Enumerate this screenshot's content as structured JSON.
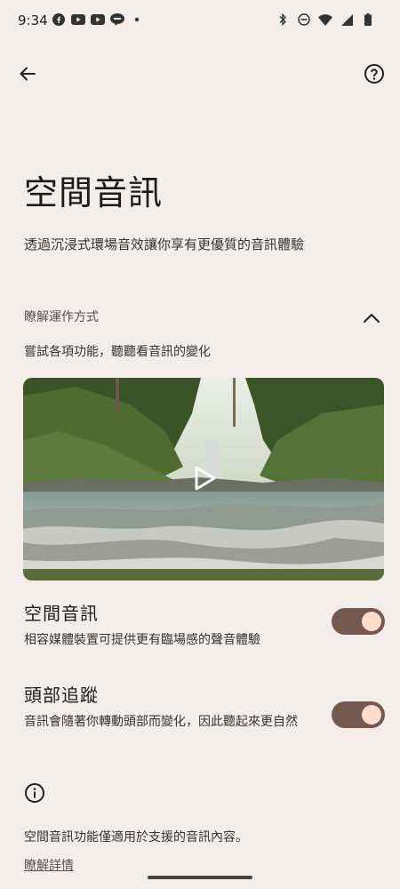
{
  "status_bar": {
    "time": "9:34",
    "left_icons": [
      "facebook-icon",
      "youtube-icon",
      "youtube-icon",
      "line-icon",
      "dot-icon"
    ],
    "right_icons": [
      "bluetooth-icon",
      "do-not-disturb-icon",
      "wifi-icon",
      "signal-icon",
      "battery-icon"
    ]
  },
  "nav": {
    "back_icon": "arrow-back-icon",
    "help_icon": "help-icon"
  },
  "page": {
    "title": "空間音訊",
    "subtitle": "透過沉浸式環場音效讓你享有更優質的音訊體驗"
  },
  "how_it_works": {
    "label": "瞭解運作方式",
    "expanded": true,
    "hint": "嘗試各項功能，聽聽看音訊的變化"
  },
  "video": {
    "play_icon": "play-icon"
  },
  "settings": [
    {
      "title": "空間音訊",
      "desc": "相容媒體裝置可提供更有臨場感的聲音體驗",
      "enabled": true
    },
    {
      "title": "頭部追蹤",
      "desc": "音訊會隨著你轉動頭部而變化，因此聽起來更自然",
      "enabled": true
    }
  ],
  "footer": {
    "info_icon": "info-icon",
    "note": "空間音訊功能僅適用於支援的音訊內容。",
    "learn_more": "瞭解詳情"
  },
  "colors": {
    "background": "#f5ede9",
    "toggle_track": "#73594f",
    "toggle_knob": "#ffdbcc"
  }
}
